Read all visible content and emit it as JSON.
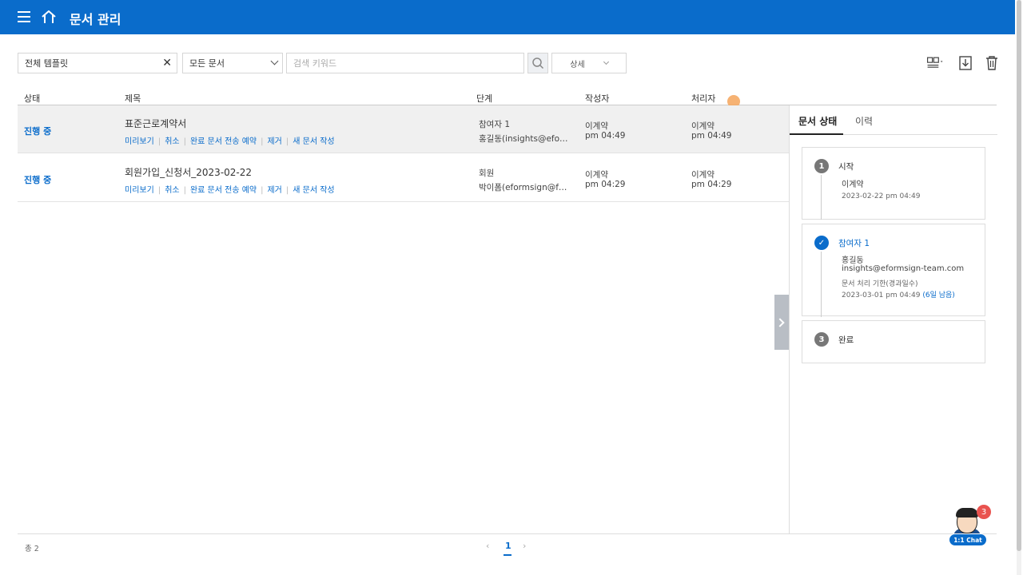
{
  "header": {
    "title": "문서 관리"
  },
  "filters": {
    "template": "전체 템플릿",
    "doc_type": "모든 문서",
    "search_placeholder": "검색 키워드",
    "detail": "상세"
  },
  "columns": {
    "status": "상태",
    "title": "제목",
    "stage": "단계",
    "author": "작성자",
    "processor": "처리자"
  },
  "rows": [
    {
      "status": "진행 중",
      "title": "표준근로계약서",
      "actions": [
        "미리보기",
        "취소",
        "완료 문서 전송 예약",
        "제거",
        "새 문서 작성"
      ],
      "stage_name": "참여자 1",
      "stage_detail": "홍길동(insights@eformsign-team.com)",
      "author": "이계약",
      "author_time": "pm 04:49",
      "processor": "이계약",
      "processor_time": "pm 04:49"
    },
    {
      "status": "진행 중",
      "title": "회원가입_신청서_2023-02-22",
      "actions": [
        "미리보기",
        "취소",
        "완료 문서 전송 예약",
        "제거",
        "새 문서 작성"
      ],
      "stage_name": "회원",
      "stage_detail": "박이폼(eformsign@formsign.com)",
      "author": "이계약",
      "author_time": "pm 04:29",
      "processor": "이계약",
      "processor_time": "pm 04:29"
    }
  ],
  "panel": {
    "tabs": [
      "문서 상태",
      "이력"
    ],
    "steps": [
      {
        "num": "1",
        "name": "시작",
        "person": "이계약",
        "date": "2023-02-22 pm 04:49"
      },
      {
        "num": "✓",
        "name": "참여자 1",
        "person": "홍길동",
        "email": "insights@eformsign-team.com",
        "deadline_label": "문서 처리 기한(경과일수)",
        "deadline": "2023-03-01 pm 04:49",
        "remaining": "(6일 남음)"
      },
      {
        "num": "3",
        "name": "완료"
      }
    ]
  },
  "footer": {
    "total": "총 2",
    "page": "1"
  },
  "chat": {
    "label": "1:1 Chat",
    "badge": "3"
  }
}
